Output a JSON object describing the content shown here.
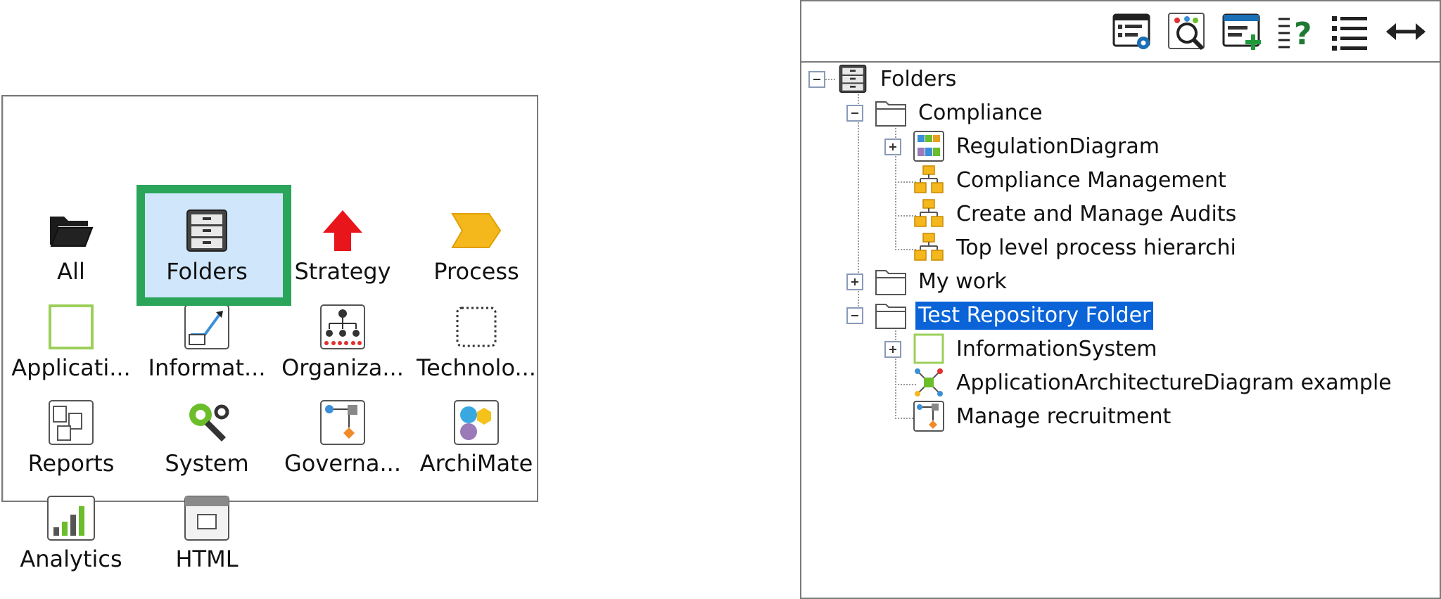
{
  "palette": {
    "categories": [
      {
        "label": "All",
        "icon": "open-folder-icon"
      },
      {
        "label": "Folders",
        "icon": "cabinet-icon",
        "selected": true
      },
      {
        "label": "Strategy",
        "icon": "red-arrow-icon"
      },
      {
        "label": "Process",
        "icon": "process-chevron-icon"
      },
      {
        "label": "Applicati...",
        "icon": "application-box-icon"
      },
      {
        "label": "Informat...",
        "icon": "information-diagram-icon"
      },
      {
        "label": "Organiza...",
        "icon": "org-chart-icon"
      },
      {
        "label": "Technolo...",
        "icon": "technology-chip-icon"
      },
      {
        "label": "Reports",
        "icon": "reports-icon"
      },
      {
        "label": "System",
        "icon": "system-wrench-icon"
      },
      {
        "label": "Governa...",
        "icon": "governance-icon"
      },
      {
        "label": "ArchiMate",
        "icon": "archimate-icon"
      },
      {
        "label": "Analytics",
        "icon": "analytics-chart-icon"
      },
      {
        "label": "HTML",
        "icon": "html-page-icon"
      }
    ],
    "selection_color": "#2aa55a",
    "selection_fill": "#cfe6fb"
  },
  "toolbar": {
    "buttons": [
      {
        "name": "settings-list-icon"
      },
      {
        "name": "search-diagram-icon"
      },
      {
        "name": "add-window-icon"
      },
      {
        "name": "help-list-icon"
      },
      {
        "name": "list-view-icon"
      },
      {
        "name": "expand-width-icon"
      }
    ]
  },
  "tree": {
    "nodes": [
      {
        "label": "Folders",
        "level": 0,
        "expander": "minus",
        "icon": "cabinet-icon"
      },
      {
        "label": "Compliance",
        "level": 1,
        "expander": "minus",
        "icon": "folder-icon"
      },
      {
        "label": "RegulationDiagram",
        "level": 2,
        "expander": "plus",
        "icon": "regulation-diagram-icon"
      },
      {
        "label": "Compliance Management",
        "level": 2,
        "expander": "none",
        "icon": "process-hierarchy-icon"
      },
      {
        "label": "Create and Manage Audits",
        "level": 2,
        "expander": "none",
        "icon": "process-hierarchy-icon"
      },
      {
        "label": "Top level process hierarchi",
        "level": 2,
        "expander": "none",
        "icon": "process-hierarchy-icon"
      },
      {
        "label": "My work",
        "level": 1,
        "expander": "plus",
        "icon": "folder-icon"
      },
      {
        "label": "Test Repository Folder",
        "level": 1,
        "expander": "minus",
        "icon": "folder-icon",
        "selected": true
      },
      {
        "label": "InformationSystem",
        "level": 2,
        "expander": "plus",
        "icon": "information-system-icon"
      },
      {
        "label": "ApplicationArchitectureDiagram example",
        "level": 2,
        "expander": "none",
        "icon": "application-architecture-icon"
      },
      {
        "label": "Manage recruitment",
        "level": 2,
        "expander": "none",
        "icon": "governance-icon"
      }
    ],
    "selection_color": "#0a64d8"
  }
}
